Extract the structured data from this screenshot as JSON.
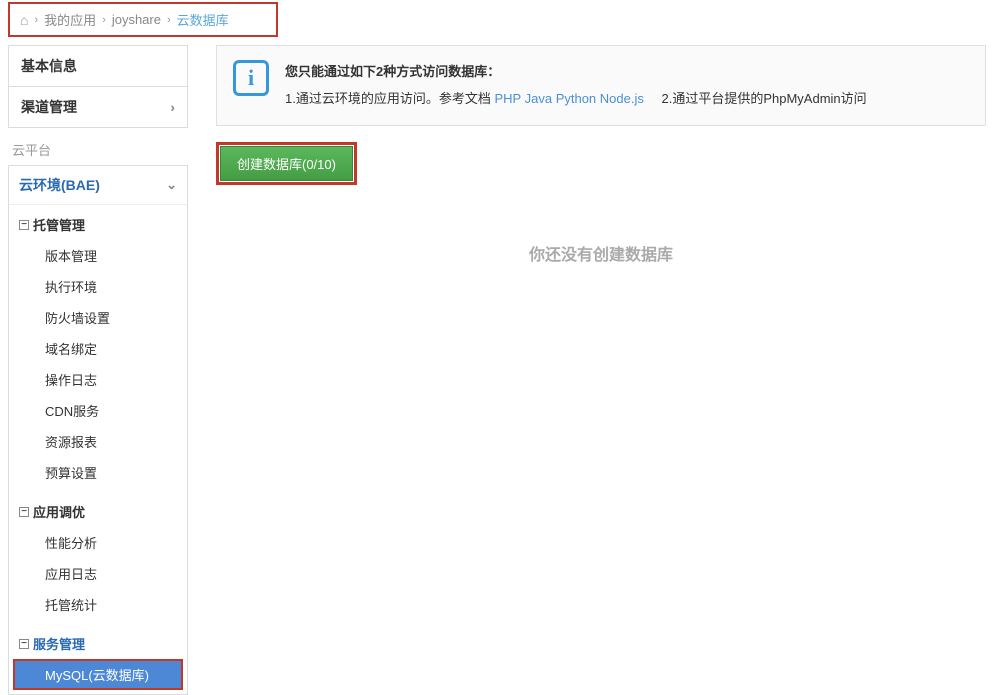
{
  "breadcrumb": {
    "home_icon": "⌂",
    "items": [
      "我的应用",
      "joyshare",
      "云数据库"
    ]
  },
  "sidebar": {
    "main_nav": [
      {
        "label": "基本信息"
      },
      {
        "label": "渠道管理",
        "has_chevron": true
      }
    ],
    "platform_label": "云平台",
    "section_head": "云环境(BAE)",
    "groups": [
      {
        "label": "托管管理",
        "items": [
          "版本管理",
          "执行环境",
          "防火墙设置",
          "域名绑定",
          "操作日志",
          "CDN服务",
          "资源报表",
          "预算设置"
        ]
      },
      {
        "label": "应用调优",
        "items": [
          "性能分析",
          "应用日志",
          "托管统计"
        ]
      },
      {
        "label": "服务管理",
        "active": true,
        "items": [
          "MySQL(云数据库)"
        ],
        "selected_index": 0
      }
    ]
  },
  "info": {
    "icon_glyph": "i",
    "title": "您只能通过如下2种方式访问数据库：",
    "line1_prefix": "1.通过云环境的应用访问。参考文档 ",
    "links": [
      "PHP",
      "Java",
      "Python",
      "Node.js"
    ],
    "line2": "2.通过平台提供的PhpMyAdmin访问"
  },
  "create_button": "创建数据库(0/10)",
  "empty_state": "你还没有创建数据库"
}
